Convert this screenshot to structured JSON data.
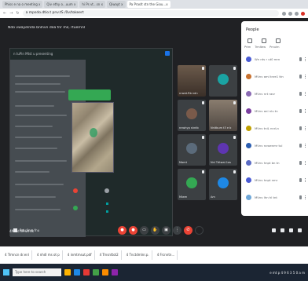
{
  "browser": {
    "tabs": [
      {
        "label": "Phiss e na o meeting  x"
      },
      {
        "label": "Qiv ethy o...uum  x"
      },
      {
        "label": "hi Ps vt...sn  x"
      },
      {
        "label": "Qiwayt  x"
      },
      {
        "label": "Pa  Praslt stn the  Giou...x"
      }
    ],
    "url": "a  mpsdo.dtio.t pnv.tS  /0v/tokeert"
  },
  "meet": {
    "title": "Ndo vwayelnda bnlnvn  dea fnr mil, rtuernnl",
    "presentation": {
      "presenter_label": "n  tuPin Mtst u presenting",
      "footer_label": "Pst rilem fnu"
    },
    "participants": [
      {
        "name": "nrwat.Rb ndn"
      },
      {
        "name": ""
      },
      {
        "name": "nnwhyp shntb"
      },
      {
        "name": "Nnltbum t3 e b"
      },
      {
        "name": "Mamt"
      },
      {
        "name": "Nnl Tdtwal.1as"
      },
      {
        "name": "Miwm"
      },
      {
        "name": "Am"
      }
    ],
    "meeting_code": "4Mfnd   NPw4 ok",
    "controls": {
      "mic": "mic-off",
      "camera": "camera-off",
      "captions": "cc",
      "hand": "raise-hand",
      "present": "present",
      "more": "more",
      "end": "end-call"
    }
  },
  "people": {
    "title": "People",
    "tabs": [
      "Prtm",
      "Trmltew",
      "Prnulrn"
    ],
    "members": [
      {
        "name": "Wn nts r ut0 mrn",
        "color": "#4a5bd4"
      },
      {
        "name": "MVnv aml tnre1 ttn",
        "color": "#c8712f"
      },
      {
        "name": "MVnv nrt  ravr",
        "color": "#8a6ab3"
      },
      {
        "name": "MVnv anl  nlu tn",
        "color": "#7b3fa0"
      },
      {
        "name": "MVnv tniL  nnrLn",
        "color": "#c0a000"
      },
      {
        "name": "MVnv ncwenmr tul",
        "color": "#2a5db0"
      },
      {
        "name": "MVnv hnpt bn  tn",
        "color": "#5a6bc4"
      },
      {
        "name": "MVnv hnpt  nmr",
        "color": "#4a5bd4"
      },
      {
        "name": "MVnv lhn  hl tnt",
        "color": "#6fa7d8"
      }
    ]
  },
  "downloads": [
    {
      "label": "4 Trmncn  dr.enl"
    },
    {
      "label": "4  nhdl ms ot p"
    },
    {
      "label": "4  inmtmsut.pdf"
    },
    {
      "label": "4  Trnsnttot2"
    },
    {
      "label": "4  Tnctdmlnr.p."
    },
    {
      "label": "4  Frcnntn..."
    }
  ],
  "taskbar": {
    "search": "Type here to search",
    "time": "e  mt  p  4 9 6 3 5 0 a m"
  },
  "colors": {
    "meet_bg": "#202124",
    "accent_green": "#34a853",
    "end_call_red": "#ea4335",
    "panel_white": "#ffffff"
  }
}
